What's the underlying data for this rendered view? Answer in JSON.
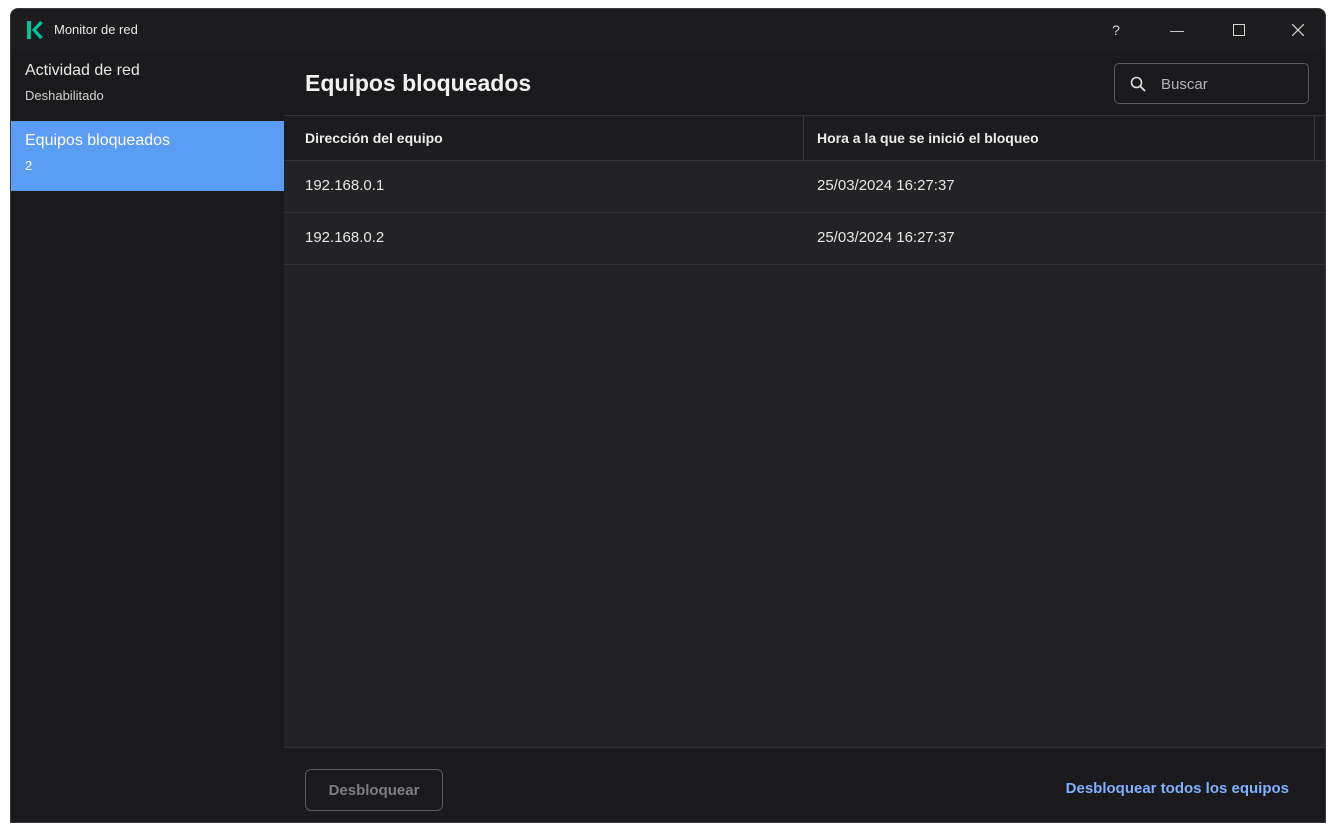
{
  "window": {
    "title": "Monitor de red",
    "controls": {
      "help": "?",
      "minimize": "—",
      "maximize": "☐",
      "close": "✕"
    }
  },
  "sidebar": {
    "items": [
      {
        "label": "Actividad de red",
        "sub": "Deshabilitado",
        "active": false
      },
      {
        "label": "Equipos bloqueados",
        "sub": "2",
        "active": true
      }
    ]
  },
  "main": {
    "title": "Equipos bloqueados",
    "search": {
      "placeholder": "Buscar",
      "icon": "search-icon"
    },
    "table": {
      "columns": [
        "Dirección del equipo",
        "Hora a la que se inició el bloqueo"
      ],
      "rows": [
        [
          "192.168.0.1",
          "25/03/2024 16:27:37"
        ],
        [
          "192.168.0.2",
          "25/03/2024 16:27:37"
        ]
      ]
    },
    "footer": {
      "unblock_label": "Desbloquear",
      "unblock_all_label": "Desbloquear todos los equipos"
    }
  },
  "colors": {
    "accent": "#5b9cf5",
    "link": "#7fb0ff",
    "logo": "#00c49a"
  }
}
